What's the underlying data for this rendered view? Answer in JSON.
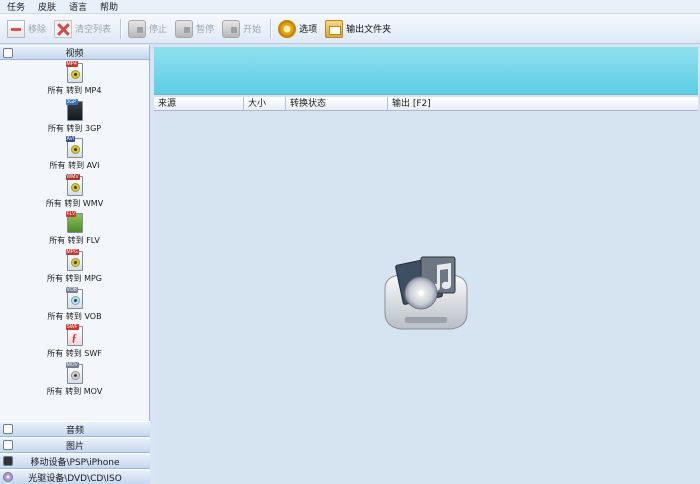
{
  "menu": [
    "任务",
    "皮肤",
    "语言",
    "帮助"
  ],
  "toolbar": {
    "remove": "移除",
    "clear": "清空列表",
    "stop": "停止",
    "pause": "暂停",
    "start": "开始",
    "options": "选项",
    "output_folder": "输出文件夹"
  },
  "sidebar": {
    "video_header": "视频",
    "video_items": [
      {
        "tag": "MP4",
        "label": "所有 转到 MP4"
      },
      {
        "tag": "3GP",
        "label": "所有 转到 3GP"
      },
      {
        "tag": "AVI",
        "label": "所有 转到 AVI"
      },
      {
        "tag": "WMV",
        "label": "所有 转到 WMV"
      },
      {
        "tag": "FLV",
        "label": "所有 转到 FLV"
      },
      {
        "tag": "MPG",
        "label": "所有 转到 MPG"
      },
      {
        "tag": "VOB",
        "label": "所有 转到 VOB"
      },
      {
        "tag": "SWF",
        "label": "所有 转到 SWF"
      },
      {
        "tag": "MOV",
        "label": "所有 转到 MOV"
      }
    ],
    "audio_header": "音频",
    "image_header": "图片",
    "mobile_header": "移动设备\\PSP\\iPhone",
    "disc_header": "光驱设备\\DVD\\CD\\ISO"
  },
  "table": {
    "columns": [
      "来源",
      "大小",
      "转换状态",
      "输出 [F2]"
    ]
  },
  "colors": {
    "banner": "#5ccde3",
    "panel": "#d6e3f1"
  }
}
